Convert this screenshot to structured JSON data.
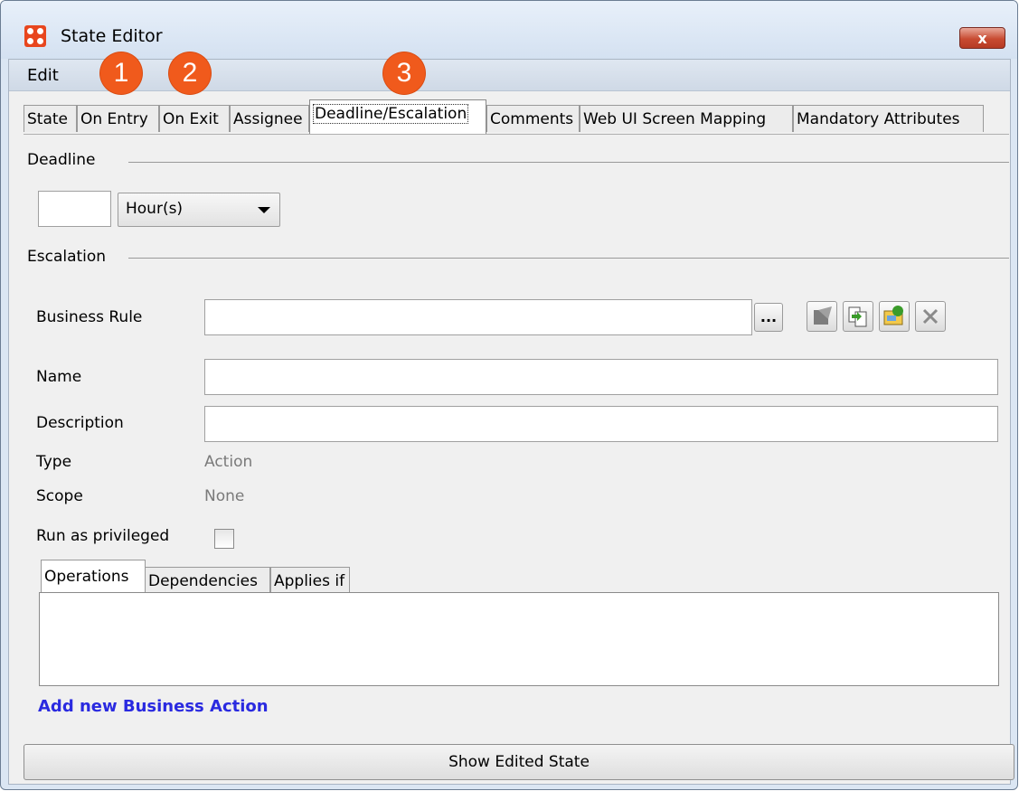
{
  "window": {
    "title": "State Editor",
    "close_label": "x"
  },
  "menu": {
    "edit": "Edit"
  },
  "callouts": [
    "1",
    "2",
    "3"
  ],
  "tabs": [
    "State",
    "On Entry",
    "On Exit",
    "Assignee",
    "Deadline/Escalation",
    "Comments",
    "Web UI Screen Mapping",
    "Mandatory Attributes"
  ],
  "active_tab": "Deadline/Escalation",
  "deadline": {
    "label": "Deadline",
    "value": "",
    "unit": "Hour(s)"
  },
  "escalation": {
    "label": "Escalation",
    "business_rule_label": "Business Rule",
    "business_rule_value": "",
    "browse_label": "...",
    "name_label": "Name",
    "name_value": "",
    "description_label": "Description",
    "description_value": "",
    "type_label": "Type",
    "type_value": "Action",
    "scope_label": "Scope",
    "scope_value": "None",
    "privileged_label": "Run as privileged",
    "privileged_checked": false
  },
  "subtabs": [
    "Operations",
    "Dependencies",
    "Applies if"
  ],
  "add_action_link": "Add new Business Action",
  "show_state_button": "Show Edited State",
  "colors": {
    "accent": "#f05a1c",
    "link": "#2a2ae0",
    "close": "#c84b32"
  }
}
